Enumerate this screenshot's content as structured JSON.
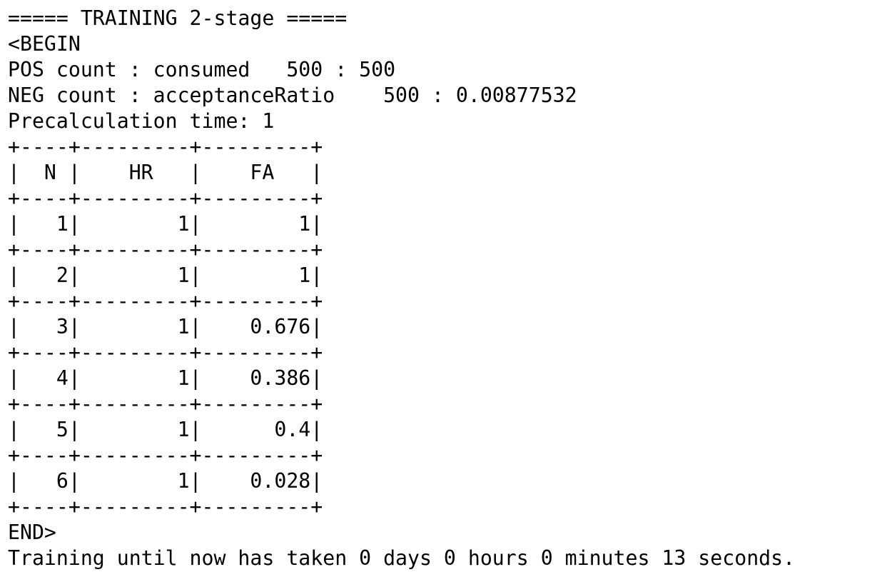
{
  "terminal": {
    "foreground": "#000000",
    "background": "#ffffff",
    "lines": [
      "===== TRAINING 2-stage =====",
      "<BEGIN",
      "POS count : consumed   500 : 500",
      "NEG count : acceptanceRatio    500 : 0.00877532",
      "Precalculation time: 1",
      "+----+---------+---------+",
      "|  N |    HR   |    FA   |",
      "+----+---------+---------+",
      "|   1|        1|        1|",
      "+----+---------+---------+",
      "|   2|        1|        1|",
      "+----+---------+---------+",
      "|   3|        1|    0.676|",
      "+----+---------+---------+",
      "|   4|        1|    0.386|",
      "+----+---------+---------+",
      "|   5|        1|      0.4|",
      "+----+---------+---------+",
      "|   6|        1|    0.028|",
      "+----+---------+---------+",
      "END>",
      "Training until now has taken 0 days 0 hours 0 minutes 13 seconds."
    ]
  }
}
